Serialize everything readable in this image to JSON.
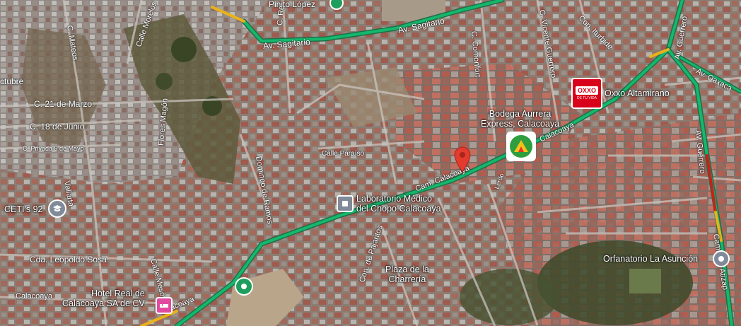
{
  "labels": {
    "pinito_lopez": "Pinito López",
    "av_sagitario_1": "Av. Sagitario",
    "av_sagitario_2": "Av. Sagitario",
    "c_mateos": "C. Mateos",
    "calle_morelos": "Calle Morelos",
    "c_re": "C. Re",
    "c_comonfort": "C. Comonfort",
    "c_vicente_guerrero": "C. Vicente Guerrero",
    "con_iturbide": "Con. Iturbide",
    "av_guerrero": "Av. Guerrero",
    "av_oaxaca": "Av. Oaxaca",
    "av_guerrero_2": "Av. Guerrero",
    "octubre": "ctubre",
    "c_21_marzo": "C. 21 de Marzo",
    "c_18_junio": "C. 18 de Junio",
    "c_privada_mayo": "C. Privada 5 de Mayo",
    "flores_magon": "Flores Magón",
    "vallarta": "Vallarta",
    "domingo_ramos": "Domingo de Ramos",
    "calle_paraiso": "Calle Paraíso",
    "cda_leopoldo": "Cda. Leopoldo Sosa",
    "calle_meson": "Calle Mesón",
    "calacoaya_left": "Calacoaya",
    "calacoaya_bottom": "Calacoaya",
    "cam_calacoaya": "Cam. Calacoaya",
    "calacoaya_upper": "Calacoaya",
    "con_pajaritos": "Con. de Pajaritos",
    "lerdo": "Lerdo",
    "camino_a_atizap": "Camino a Atizap"
  },
  "pois": {
    "oxxo": {
      "name": "Oxxo Altamirano",
      "logo": "OXXO",
      "tagline": "DE TU VIDA"
    },
    "bodega": {
      "name_line1": "Bodega Aurrera",
      "name_line2": "Express, Calacoaya"
    },
    "lab": {
      "name_line1": "Laboratorio Médico",
      "name_line2": "del Chopo Calacoaya"
    },
    "ceti": {
      "name": "CETI's 92"
    },
    "plaza": {
      "name_line1": "Plaza de la",
      "name_line2": "Charrería"
    },
    "hotel": {
      "name_line1": "Hotel Real de",
      "name_line2": "Calacoaya SA de CV"
    },
    "orfanatorio": {
      "name": "Orfanatorio La Asunción"
    }
  },
  "colors": {
    "traffic_green": "#15b86b",
    "traffic_yellow": "#e8b21a",
    "traffic_red": "#c8201a",
    "pin_red": "#e33b2e",
    "oxxo_red": "#d8001a",
    "hotel_pink": "#e24a9f",
    "park_green": "#1e9e5c",
    "poi_gray": "#808a99"
  }
}
